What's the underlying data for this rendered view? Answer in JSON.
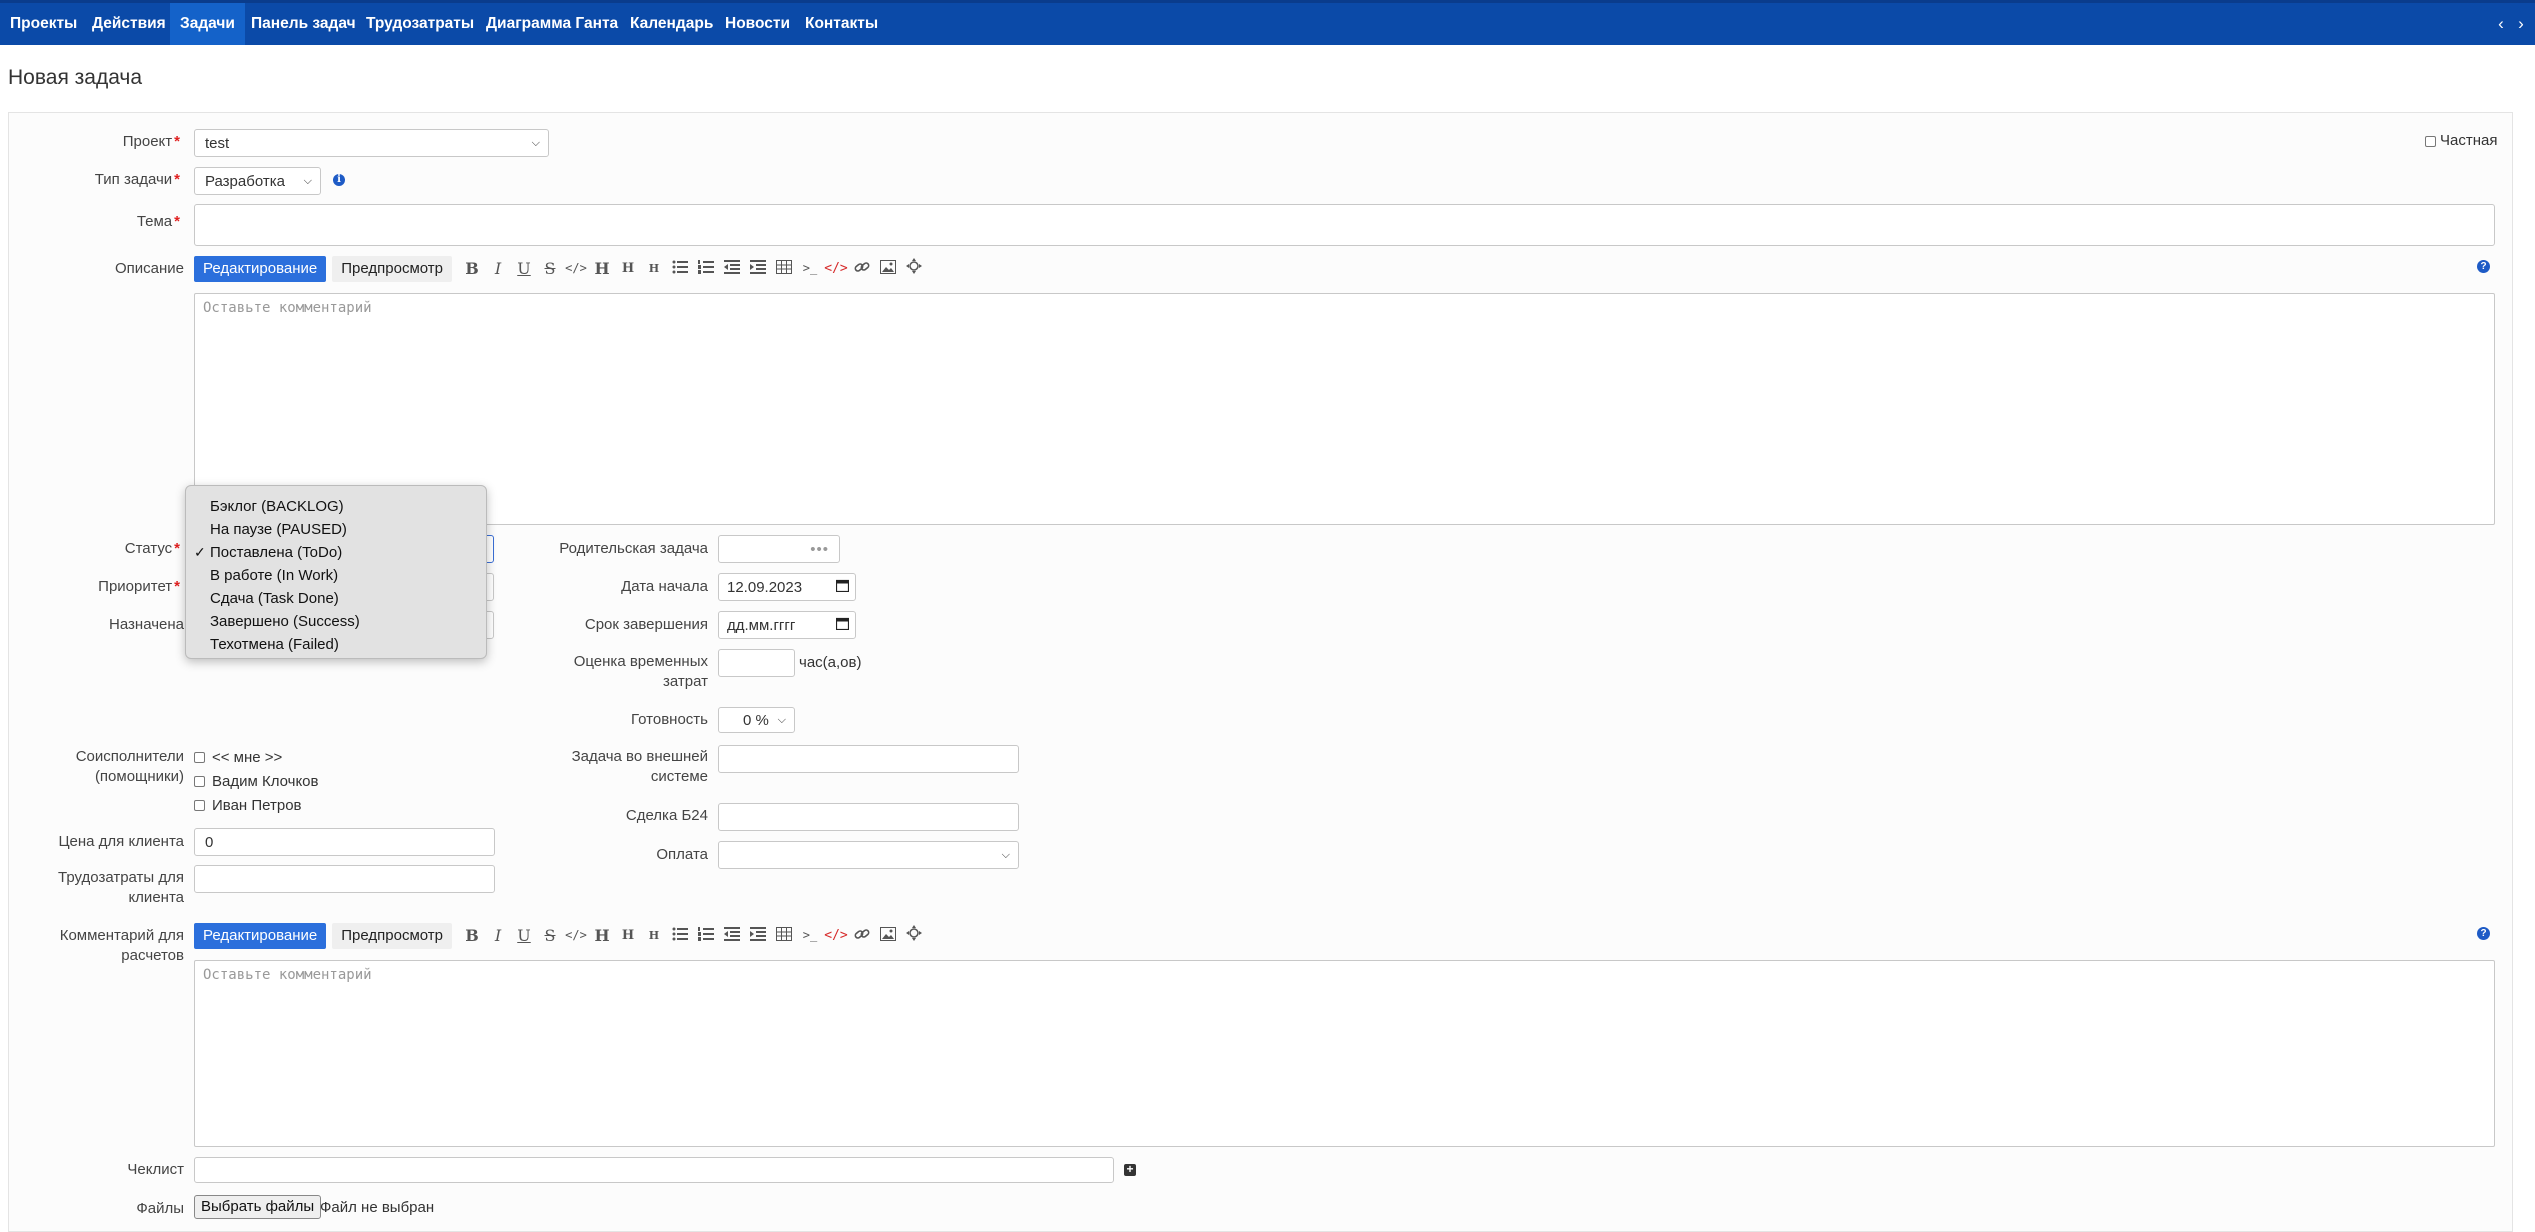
{
  "menu": {
    "items": [
      "Проекты",
      "Действия",
      "Задачи",
      "Панель задач",
      "Трудозатраты",
      "Диаграмма Ганта",
      "Календарь",
      "Новости",
      "Контакты"
    ],
    "active": "Задачи",
    "left_arrow": "‹",
    "right_arrow": "›"
  },
  "page": {
    "title": "Новая задача"
  },
  "form": {
    "project": {
      "label": "Проект",
      "value": "test"
    },
    "private": {
      "label": "Частная",
      "checked": false
    },
    "tracker": {
      "label": "Тип задачи",
      "value": "Разработка",
      "info_icon": "info-icon"
    },
    "subject": {
      "label": "Тема",
      "value": ""
    },
    "description": {
      "label": "Описание",
      "edit_tab": "Редактирование",
      "preview_tab": "Предпросмотр",
      "placeholder": "Оставьте комментарий"
    },
    "status": {
      "label": "Статус",
      "options": [
        "Бэклог (BACKLOG)",
        "На паузе (PAUSED)",
        "Поставлена (ToDo)",
        "В работе (In Work)",
        "Сдача (Task Done)",
        "Завершено (Success)",
        "Техотмена (Failed)"
      ],
      "selected": "Поставлена (ToDo)"
    },
    "priority": {
      "label": "Приоритет"
    },
    "assignee": {
      "label": "Назначена"
    },
    "parent": {
      "label": "Родительская задача",
      "value": ""
    },
    "start_date": {
      "label": "Дата начала",
      "value": "12.09.2023"
    },
    "due_date": {
      "label": "Срок завершения",
      "value": "дд.мм.гггг"
    },
    "estimated": {
      "label_line1": "Оценка временных",
      "label_line2": "затрат",
      "unit": "час(а,ов)",
      "value": ""
    },
    "done_ratio": {
      "label": "Готовность",
      "value": "0 %"
    },
    "watchers": {
      "label_line1": "Соисполнители",
      "label_line2": "(помощники)",
      "items": [
        "<< мне >>",
        "Вадим Клочков",
        "Иван Петров"
      ]
    },
    "external_task": {
      "label_line1": "Задача во внешней",
      "label_line2": "системе",
      "value": ""
    },
    "client_price": {
      "label": "Цена для клиента",
      "value": "0"
    },
    "deal": {
      "label": "Сделка Б24",
      "value": ""
    },
    "client_hours": {
      "label_line1": "Трудозатраты для",
      "label_line2": "клиента",
      "value": ""
    },
    "payment": {
      "label": "Оплата",
      "value": ""
    },
    "calc_comment": {
      "label_line1": "Комментарий для",
      "label_line2": "расчетов",
      "edit_tab": "Редактирование",
      "preview_tab": "Предпросмотр",
      "placeholder": "Оставьте комментарий"
    },
    "checklist": {
      "label": "Чеклист",
      "value": ""
    },
    "files": {
      "label": "Файлы",
      "button": "Выбрать файлы",
      "status": "Файл не выбран"
    }
  },
  "toolbar": {
    "bold": "B",
    "italic": "I",
    "underline": "U",
    "strike": "S",
    "code": "</>",
    "h1": "H",
    "h2": "H",
    "h3": "H",
    "pre_icon": ">_",
    "codeblock": "</>"
  },
  "colors": {
    "menu_bg": "#0b4aa8",
    "menu_active": "#1462c9",
    "accent": "#2b6fdc",
    "required": "#e02020"
  }
}
